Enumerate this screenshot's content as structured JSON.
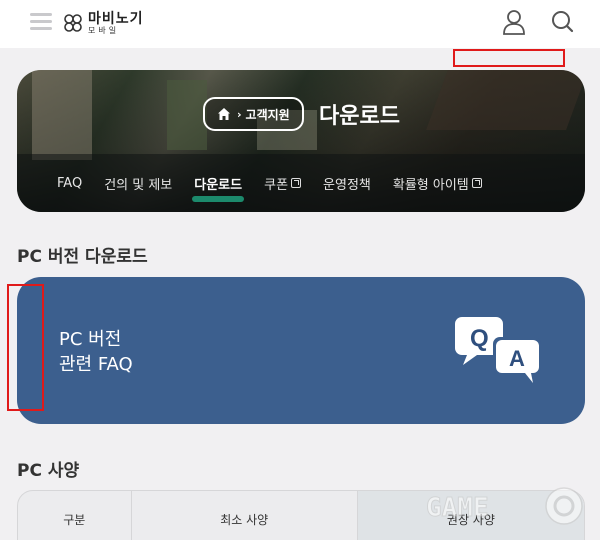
{
  "header": {
    "logo_main": "마비노기",
    "logo_sub": "모바일"
  },
  "banner": {
    "breadcrumb": "고객지원",
    "title": "다운로드",
    "tabs": [
      {
        "label": "FAQ",
        "external": false,
        "active": false
      },
      {
        "label": "건의 및 제보",
        "external": false,
        "active": false
      },
      {
        "label": "다운로드",
        "external": false,
        "active": true
      },
      {
        "label": "쿠폰",
        "external": true,
        "active": false
      },
      {
        "label": "운영정책",
        "external": false,
        "active": false
      },
      {
        "label": "확률형 아이템",
        "external": true,
        "active": false
      }
    ],
    "active_color": "#1c8a6c"
  },
  "pc_download": {
    "heading": "PC 버전 다운로드",
    "faq_line1": "PC 버전",
    "faq_line2": "관련 FAQ",
    "card_color": "#3c5f8e",
    "icon_q": "Q",
    "icon_a": "A"
  },
  "pc_spec": {
    "heading": "PC 사양",
    "columns": [
      "구분",
      "최소 사양",
      "권장 사양"
    ]
  },
  "watermark_text": "GAME"
}
